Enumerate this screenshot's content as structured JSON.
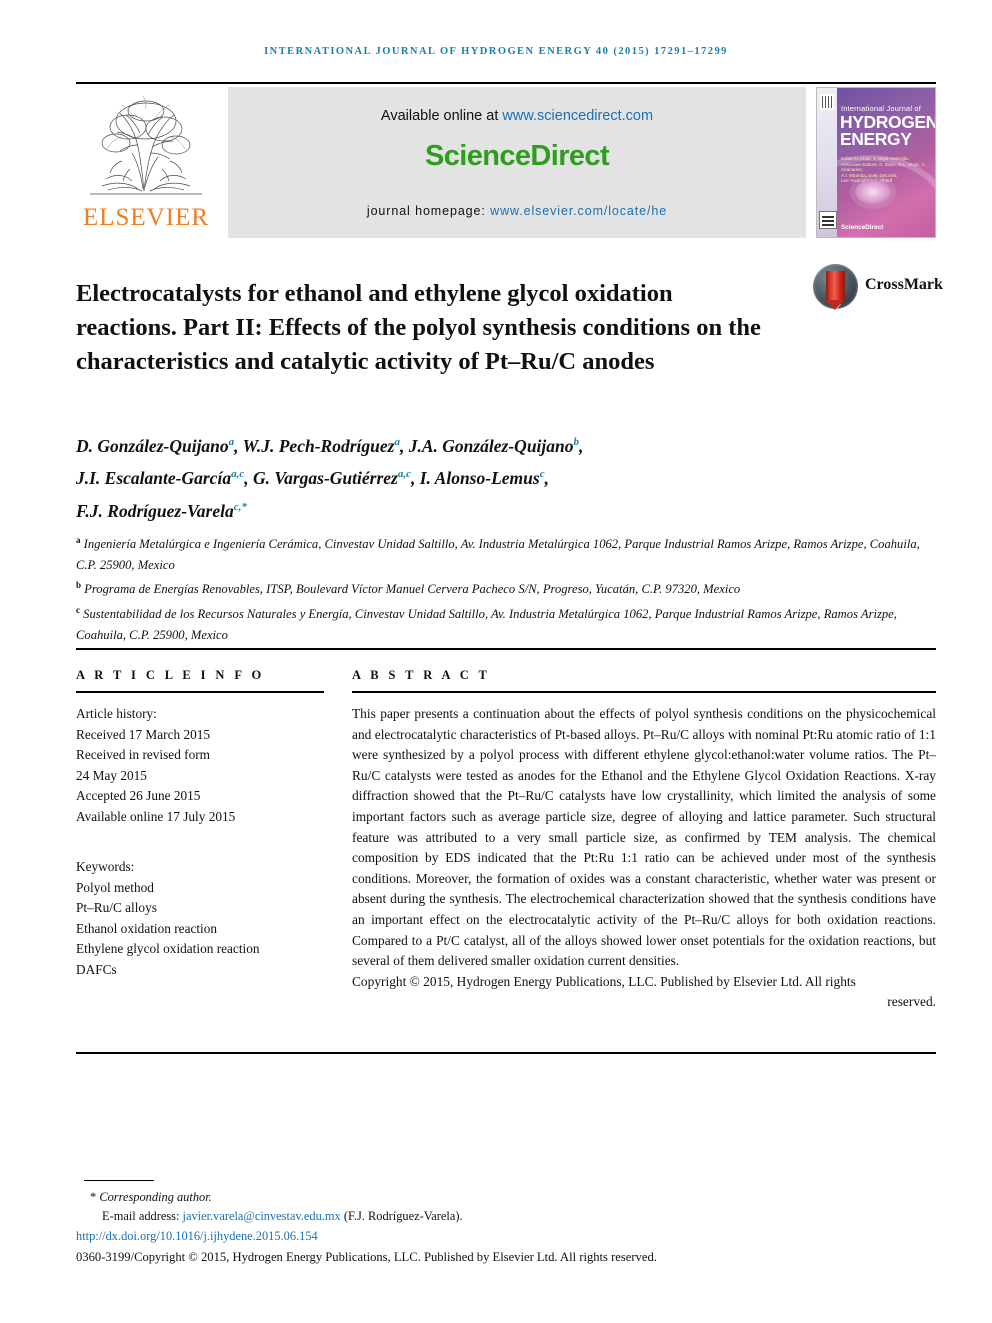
{
  "running_head": "International Journal of Hydrogen Energy 40 (2015) 17291–17299",
  "masthead": {
    "publisher_logo_text": "ELSEVIER",
    "available_online_label": "Available online at",
    "available_online_url": "www.sciencedirect.com",
    "sciencedirect_logo": "ScienceDirect",
    "journal_homepage_label": "journal homepage:",
    "journal_homepage_url": "www.elsevier.com/locate/he",
    "cover": {
      "line_small": "International Journal of",
      "line_big_1": "HYDROGEN",
      "line_big_2": "ENERGY",
      "editors": "Editor-in-Chief: T. Nejat Veziroğlu\nAssociate Editors: S. Dunn, D.L. Stojic, A. Abanades,\nA.I. Miranda, D.W. DeLuchi,\nLee Yook and S.A. Sherif",
      "science_direct_mark": "ScienceDirect"
    }
  },
  "crossmark": {
    "label": "CrossMark"
  },
  "article": {
    "title": "Electrocatalysts for ethanol and ethylene glycol oxidation reactions. Part II: Effects of the polyol synthesis conditions on the characteristics and catalytic activity of Pt–Ru/C anodes",
    "authors_lines": [
      "D. González-Quijano a, W.J. Pech-Rodríguez a, J.A. González-Quijano b,",
      "J.I. Escalante-García a,c, G. Vargas-Gutiérrez a,c, I. Alonso-Lemus c,",
      "F.J. Rodríguez-Varela c,*"
    ],
    "authors": [
      {
        "name": "D. González-Quijano",
        "affil": "a"
      },
      {
        "name": "W.J. Pech-Rodríguez",
        "affil": "a"
      },
      {
        "name": "J.A. González-Quijano",
        "affil": "b"
      },
      {
        "name": "J.I. Escalante-García",
        "affil": "a,c"
      },
      {
        "name": "G. Vargas-Gutiérrez",
        "affil": "a,c"
      },
      {
        "name": "I. Alonso-Lemus",
        "affil": "c"
      },
      {
        "name": "F.J. Rodríguez-Varela",
        "affil": "c,*"
      }
    ],
    "affiliations": [
      {
        "marker": "a",
        "text": "Ingeniería Metalúrgica e Ingeniería Cerámica, Cinvestav Unidad Saltillo, Av. Industria Metalúrgica 1062, Parque Industrial Ramos Arizpe, Ramos Arizpe, Coahuila, C.P. 25900, Mexico"
      },
      {
        "marker": "b",
        "text": "Programa de Energías Renovables, ITSP, Boulevard Víctor Manuel Cervera Pacheco S/N, Progreso, Yucatán, C.P. 97320, Mexico"
      },
      {
        "marker": "c",
        "text": "Sustentabilidad de los Recursos Naturales y Energía, Cinvestav Unidad Saltillo, Av. Industria Metalúrgica 1062, Parque Industrial Ramos Arizpe, Ramos Arizpe, Coahuila, C.P. 25900, Mexico"
      }
    ]
  },
  "article_info": {
    "heading": "A R T I C L E   I N F O",
    "history_label": "Article history:",
    "history": [
      "Received 17 March 2015",
      "Received in revised form",
      "24 May 2015",
      "Accepted 26 June 2015",
      "Available online 17 July 2015"
    ],
    "keywords_label": "Keywords:",
    "keywords": [
      "Polyol method",
      "Pt–Ru/C alloys",
      "Ethanol oxidation reaction",
      "Ethylene glycol oxidation reaction",
      "DAFCs"
    ]
  },
  "abstract": {
    "heading": "A B S T R A C T",
    "body": "This paper presents a continuation about the effects of polyol synthesis conditions on the physicochemical and electrocatalytic characteristics of Pt-based alloys. Pt–Ru/C alloys with nominal Pt:Ru atomic ratio of 1:1 were synthesized by a polyol process with different ethylene glycol:ethanol:water volume ratios. The Pt–Ru/C catalysts were tested as anodes for the Ethanol and the Ethylene Glycol Oxidation Reactions. X-ray diffraction showed that the Pt–Ru/C catalysts have low crystallinity, which limited the analysis of some important factors such as average particle size, degree of alloying and lattice parameter. Such structural feature was attributed to a very small particle size, as confirmed by TEM analysis. The chemical composition by EDS indicated that the Pt:Ru 1:1 ratio can be achieved under most of the synthesis conditions. Moreover, the formation of oxides was a constant characteristic, whether water was present or absent during the synthesis. The electrochemical characterization showed that the synthesis conditions have an important effect on the electrocatalytic activity of the Pt–Ru/C alloys for both oxidation reactions. Compared to a Pt/C catalyst, all of the alloys showed lower onset potentials for the oxidation reactions, but several of them delivered smaller oxidation current densities.",
    "copyright_line": "Copyright © 2015, Hydrogen Energy Publications, LLC. Published by Elsevier Ltd. All rights",
    "copyright_tail": "reserved."
  },
  "footer": {
    "corresponding_marker": "*",
    "corresponding_label": "Corresponding author.",
    "email_label": "E-mail address:",
    "email": "javier.varela@cinvestav.edu.mx",
    "email_owner": "(F.J. Rodríguez-Varela).",
    "doi": "http://dx.doi.org/10.1016/j.ijhydene.2015.06.154",
    "issn_line": "0360-3199/Copyright © 2015, Hydrogen Energy Publications, LLC. Published by Elsevier Ltd. All rights reserved."
  },
  "colors": {
    "running_head": "#1a7fa8",
    "elsevier_orange": "#ef7d22",
    "sciencedirect_green": "#2f9e1f",
    "link_blue": "#1a6fb5",
    "affil_marker_blue": "#1a7fa8"
  }
}
